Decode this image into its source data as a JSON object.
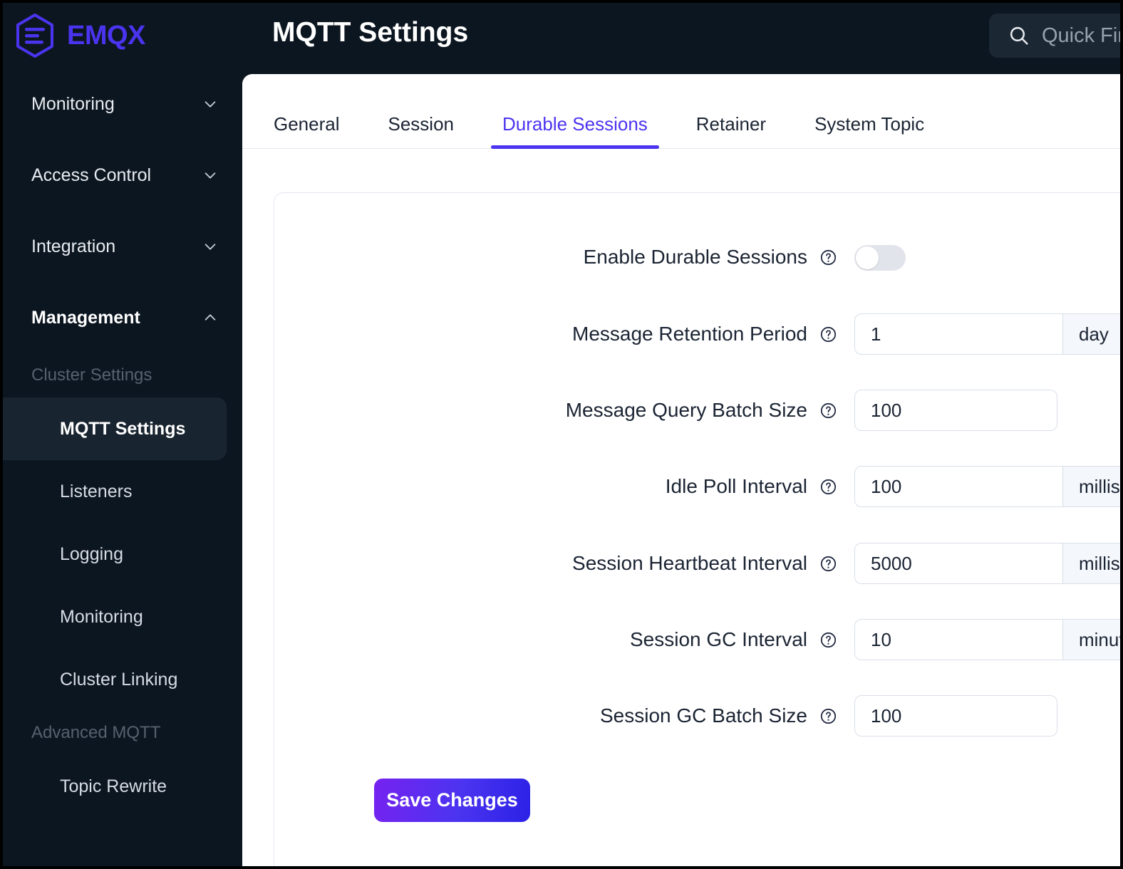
{
  "brand": {
    "name": "EMQX",
    "logo_icon": "emqx-hexagon-logo"
  },
  "header": {
    "title": "MQTT Settings",
    "search": {
      "icon": "search-icon",
      "placeholder": "Quick Find"
    }
  },
  "sidebar": {
    "groups": [
      {
        "label": "Monitoring",
        "icon": "chevron-down-icon",
        "expanded": false
      },
      {
        "label": "Access Control",
        "icon": "chevron-down-icon",
        "expanded": false
      },
      {
        "label": "Integration",
        "icon": "chevron-down-icon",
        "expanded": false
      },
      {
        "label": "Management",
        "icon": "chevron-up-icon",
        "expanded": true
      }
    ],
    "section_cluster": "Cluster Settings",
    "cluster_items": [
      {
        "label": "MQTT Settings",
        "active": true
      },
      {
        "label": "Listeners",
        "active": false
      },
      {
        "label": "Logging",
        "active": false
      },
      {
        "label": "Monitoring",
        "active": false
      },
      {
        "label": "Cluster Linking",
        "active": false
      }
    ],
    "section_advanced": "Advanced MQTT",
    "advanced_items": [
      {
        "label": "Topic Rewrite",
        "active": false
      }
    ]
  },
  "tabs": [
    {
      "label": "General",
      "active": false
    },
    {
      "label": "Session",
      "active": false
    },
    {
      "label": "Durable Sessions",
      "active": true
    },
    {
      "label": "Retainer",
      "active": false
    },
    {
      "label": "System Topic",
      "active": false
    }
  ],
  "form": {
    "help_icon": "question-mark-circle-icon",
    "chevron_icon": "chevron-down-icon",
    "fields": [
      {
        "label": "Enable Durable Sessions",
        "type": "toggle",
        "value": "off"
      },
      {
        "label": "Message Retention Period",
        "type": "combo",
        "value": "1",
        "unit": "day"
      },
      {
        "label": "Message Query Batch Size",
        "type": "text",
        "value": "100"
      },
      {
        "label": "Idle Poll Interval",
        "type": "combo",
        "value": "100",
        "unit": "milliseconds"
      },
      {
        "label": "Session Heartbeat Interval",
        "type": "combo",
        "value": "5000",
        "unit": "milliseconds"
      },
      {
        "label": "Session GC Interval",
        "type": "combo",
        "value": "10",
        "unit": "minute"
      },
      {
        "label": "Session GC Batch Size",
        "type": "text",
        "value": "100"
      }
    ],
    "save_label": "Save Changes"
  },
  "colors": {
    "accent": "#4B34F0",
    "sidebar_bg": "#0C1620",
    "sidebar_active_bg": "#18242F",
    "select_bg": "#F4F7FB",
    "toggle_off": "#E2E4EB"
  }
}
